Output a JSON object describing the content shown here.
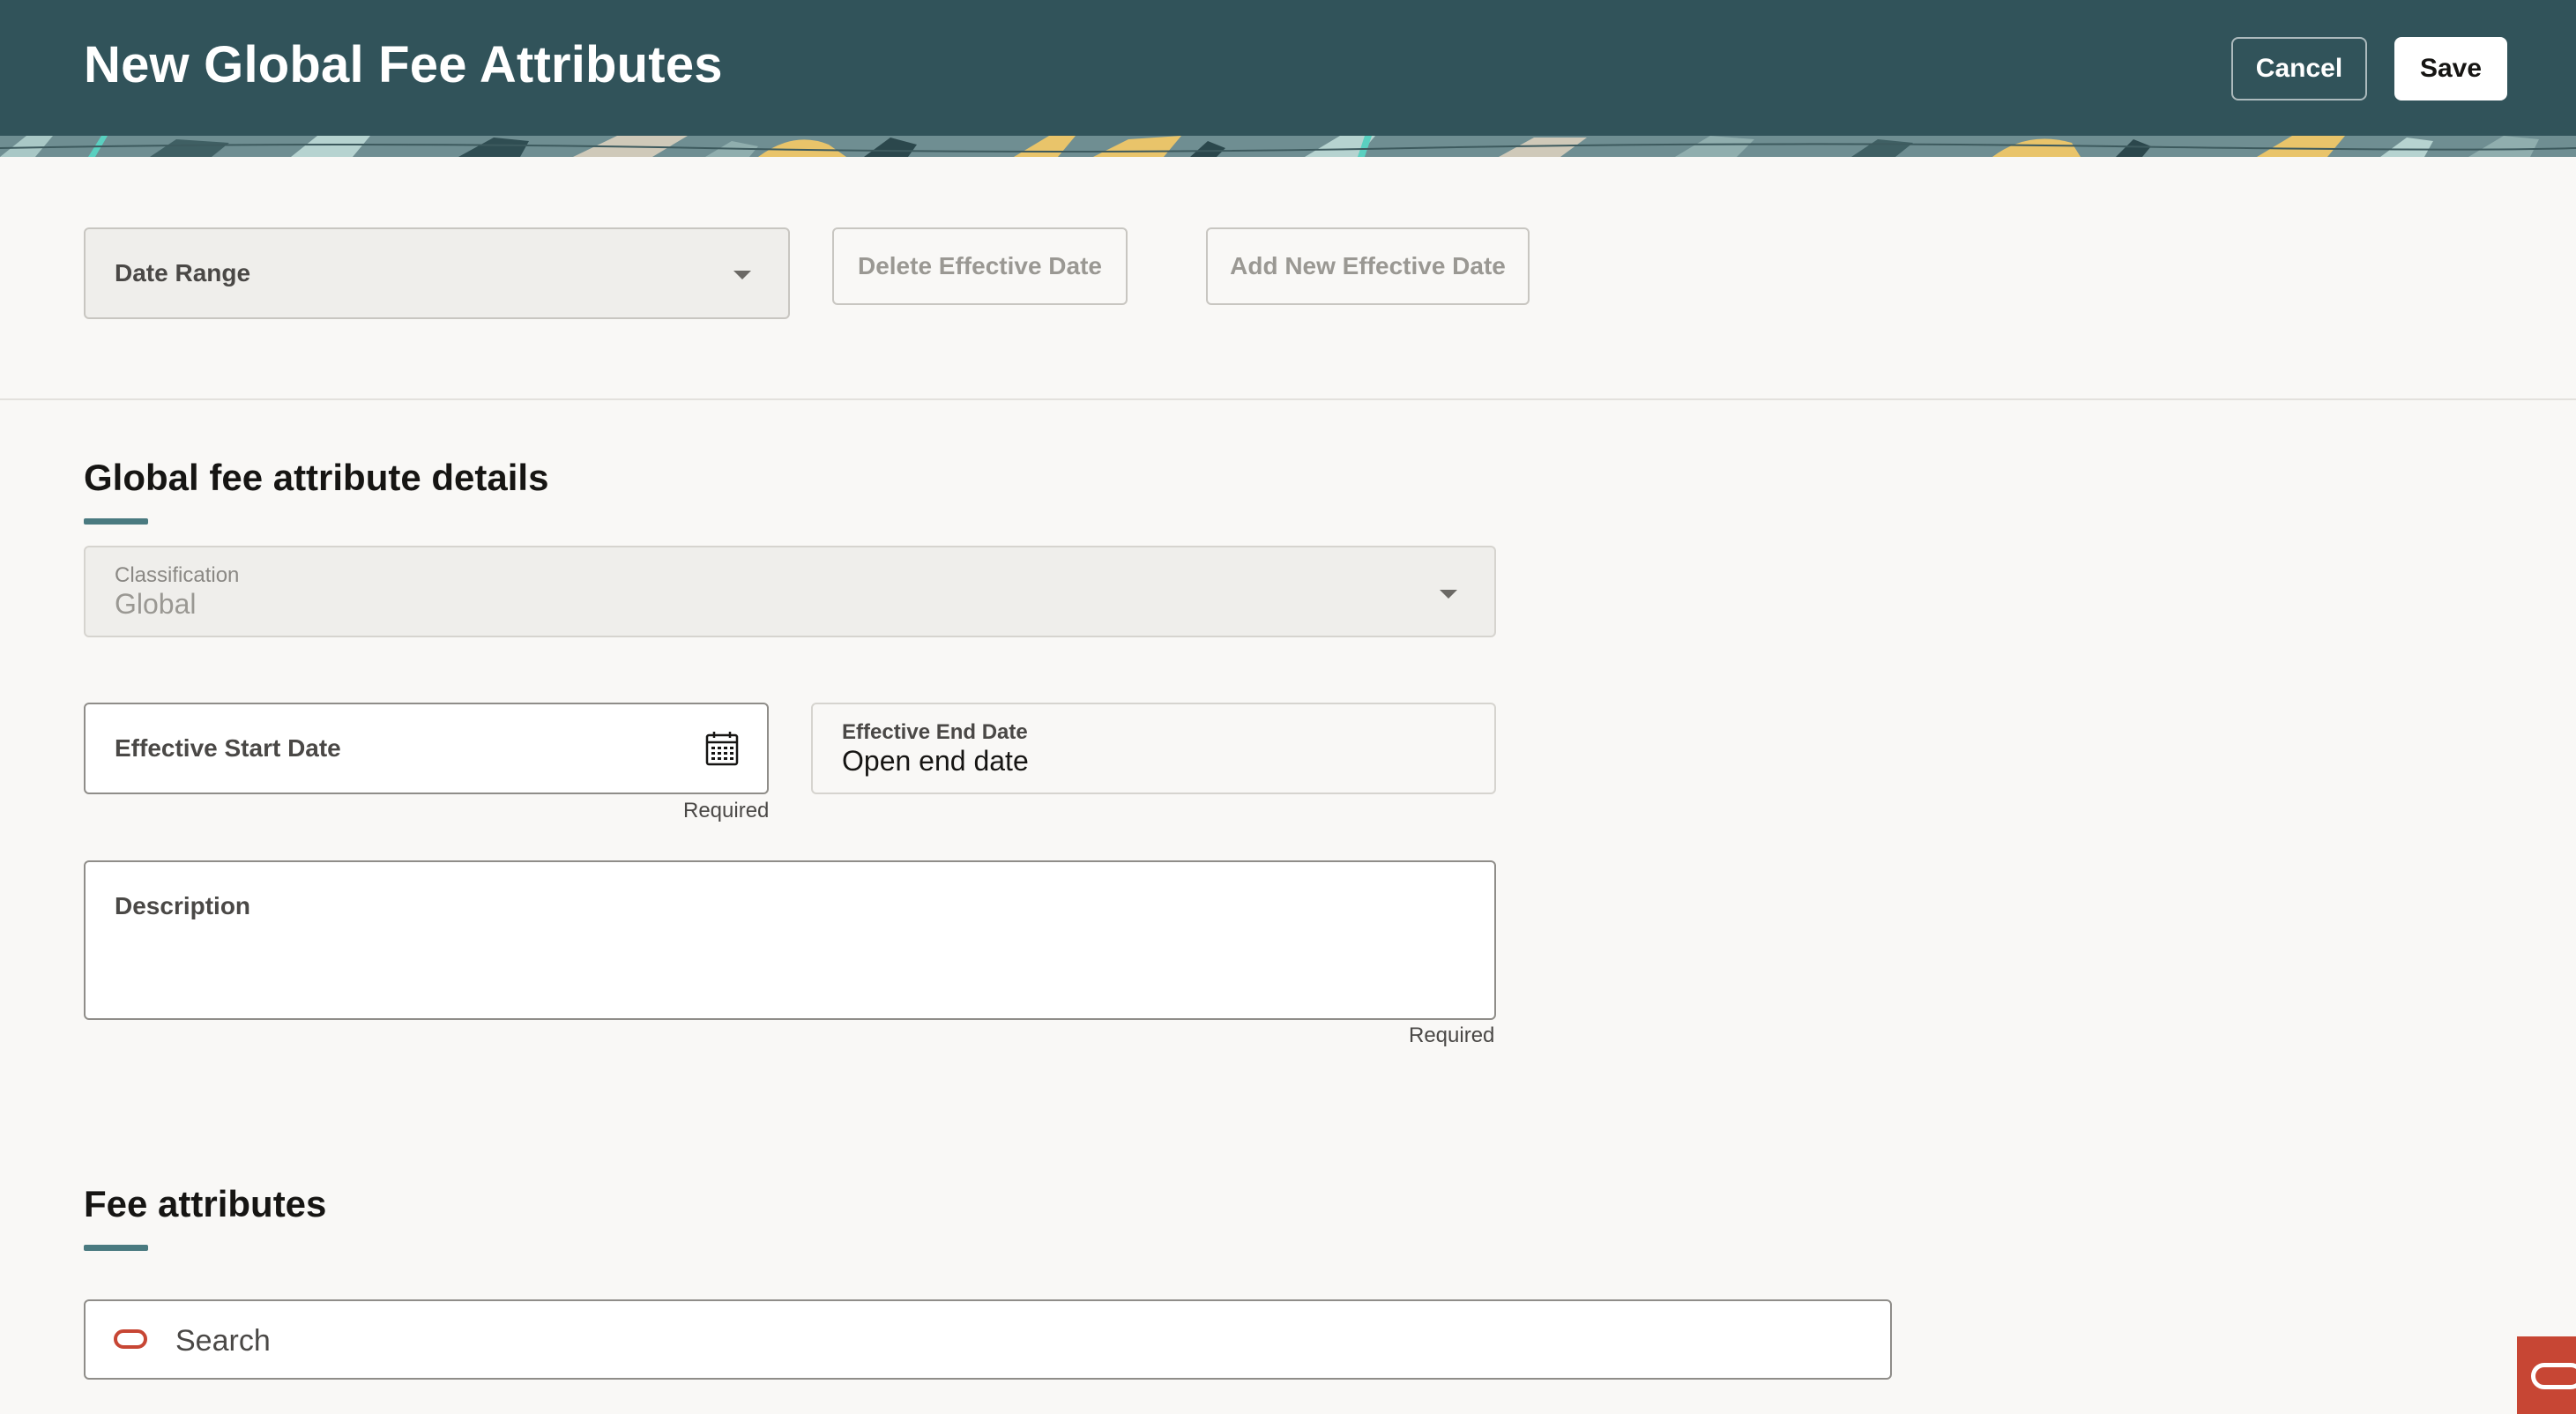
{
  "header": {
    "title": "New Global Fee Attributes",
    "cancel_label": "Cancel",
    "save_label": "Save"
  },
  "toolbar": {
    "date_range_label": "Date Range",
    "delete_effective_date_label": "Delete Effective Date",
    "add_new_effective_date_label": "Add New Effective Date"
  },
  "details": {
    "section_title": "Global fee attribute details",
    "classification": {
      "label": "Classification",
      "value": "Global"
    },
    "effective_start_date": {
      "label": "Effective Start Date",
      "helper": "Required",
      "icon": "calendar-icon"
    },
    "effective_end_date": {
      "label": "Effective End Date",
      "value": "Open end date"
    },
    "description": {
      "label": "Description",
      "helper": "Required"
    }
  },
  "fee_attributes": {
    "section_title": "Fee attributes",
    "search": {
      "placeholder": "Search",
      "icon": "search-icon"
    }
  },
  "colors": {
    "header_bg": "#31535a",
    "accent": "#4a7a80",
    "brand_red": "#c74634",
    "page_bg": "#f9f8f6"
  }
}
